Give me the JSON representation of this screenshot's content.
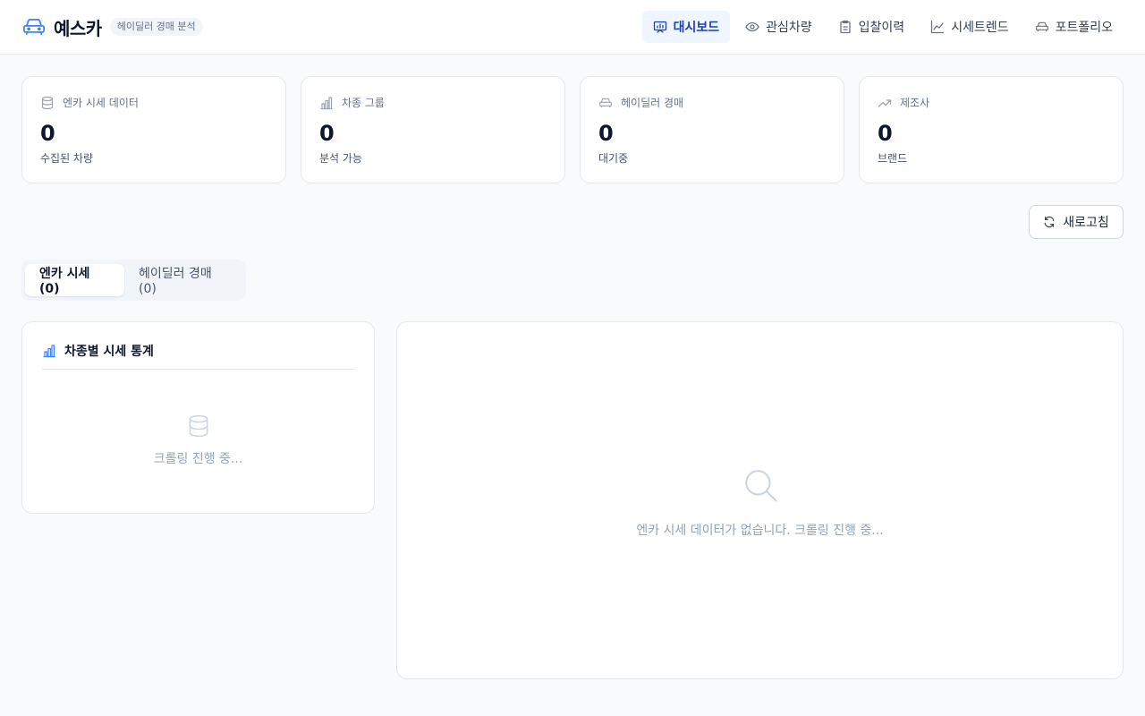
{
  "header": {
    "brand_name": "예스카",
    "brand_badge": "헤이딜러 경매 분석",
    "nav": [
      {
        "label": "대시보드",
        "icon": "presentation-chart-icon",
        "active": true
      },
      {
        "label": "관심차량",
        "icon": "eye-icon",
        "active": false
      },
      {
        "label": "입찰이력",
        "icon": "clipboard-icon",
        "active": false
      },
      {
        "label": "시세트렌드",
        "icon": "line-chart-icon",
        "active": false
      },
      {
        "label": "포트폴리오",
        "icon": "car-icon",
        "active": false
      }
    ]
  },
  "stats": [
    {
      "label": "엔카 시세 데이터",
      "value": "0",
      "sub": "수집된 차량",
      "icon": "database-icon"
    },
    {
      "label": "차종 그룹",
      "value": "0",
      "sub": "분석 가능",
      "icon": "bar-chart-icon"
    },
    {
      "label": "헤이딜러 경매",
      "value": "0",
      "sub": "대기중",
      "icon": "car-icon"
    },
    {
      "label": "제조사",
      "value": "0",
      "sub": "브랜드",
      "icon": "trending-up-icon"
    }
  ],
  "toolbar": {
    "refresh_label": "새로고침"
  },
  "tabs": [
    {
      "label": "엔카 시세 (0)",
      "active": true
    },
    {
      "label": "헤이딜러 경매 (0)",
      "active": false
    }
  ],
  "stats_panel": {
    "title": "차종별 시세 통계",
    "empty_text": "크롤링 진행 중..."
  },
  "main_panel": {
    "empty_text": "엔카 시세 데이터가 없습니다. 크롤링 진행 중..."
  },
  "colors": {
    "accent": "#1e40af",
    "accent_bg": "#eff6ff",
    "brand_icon": "#3b82f6",
    "muted_text": "#94a3b8"
  }
}
